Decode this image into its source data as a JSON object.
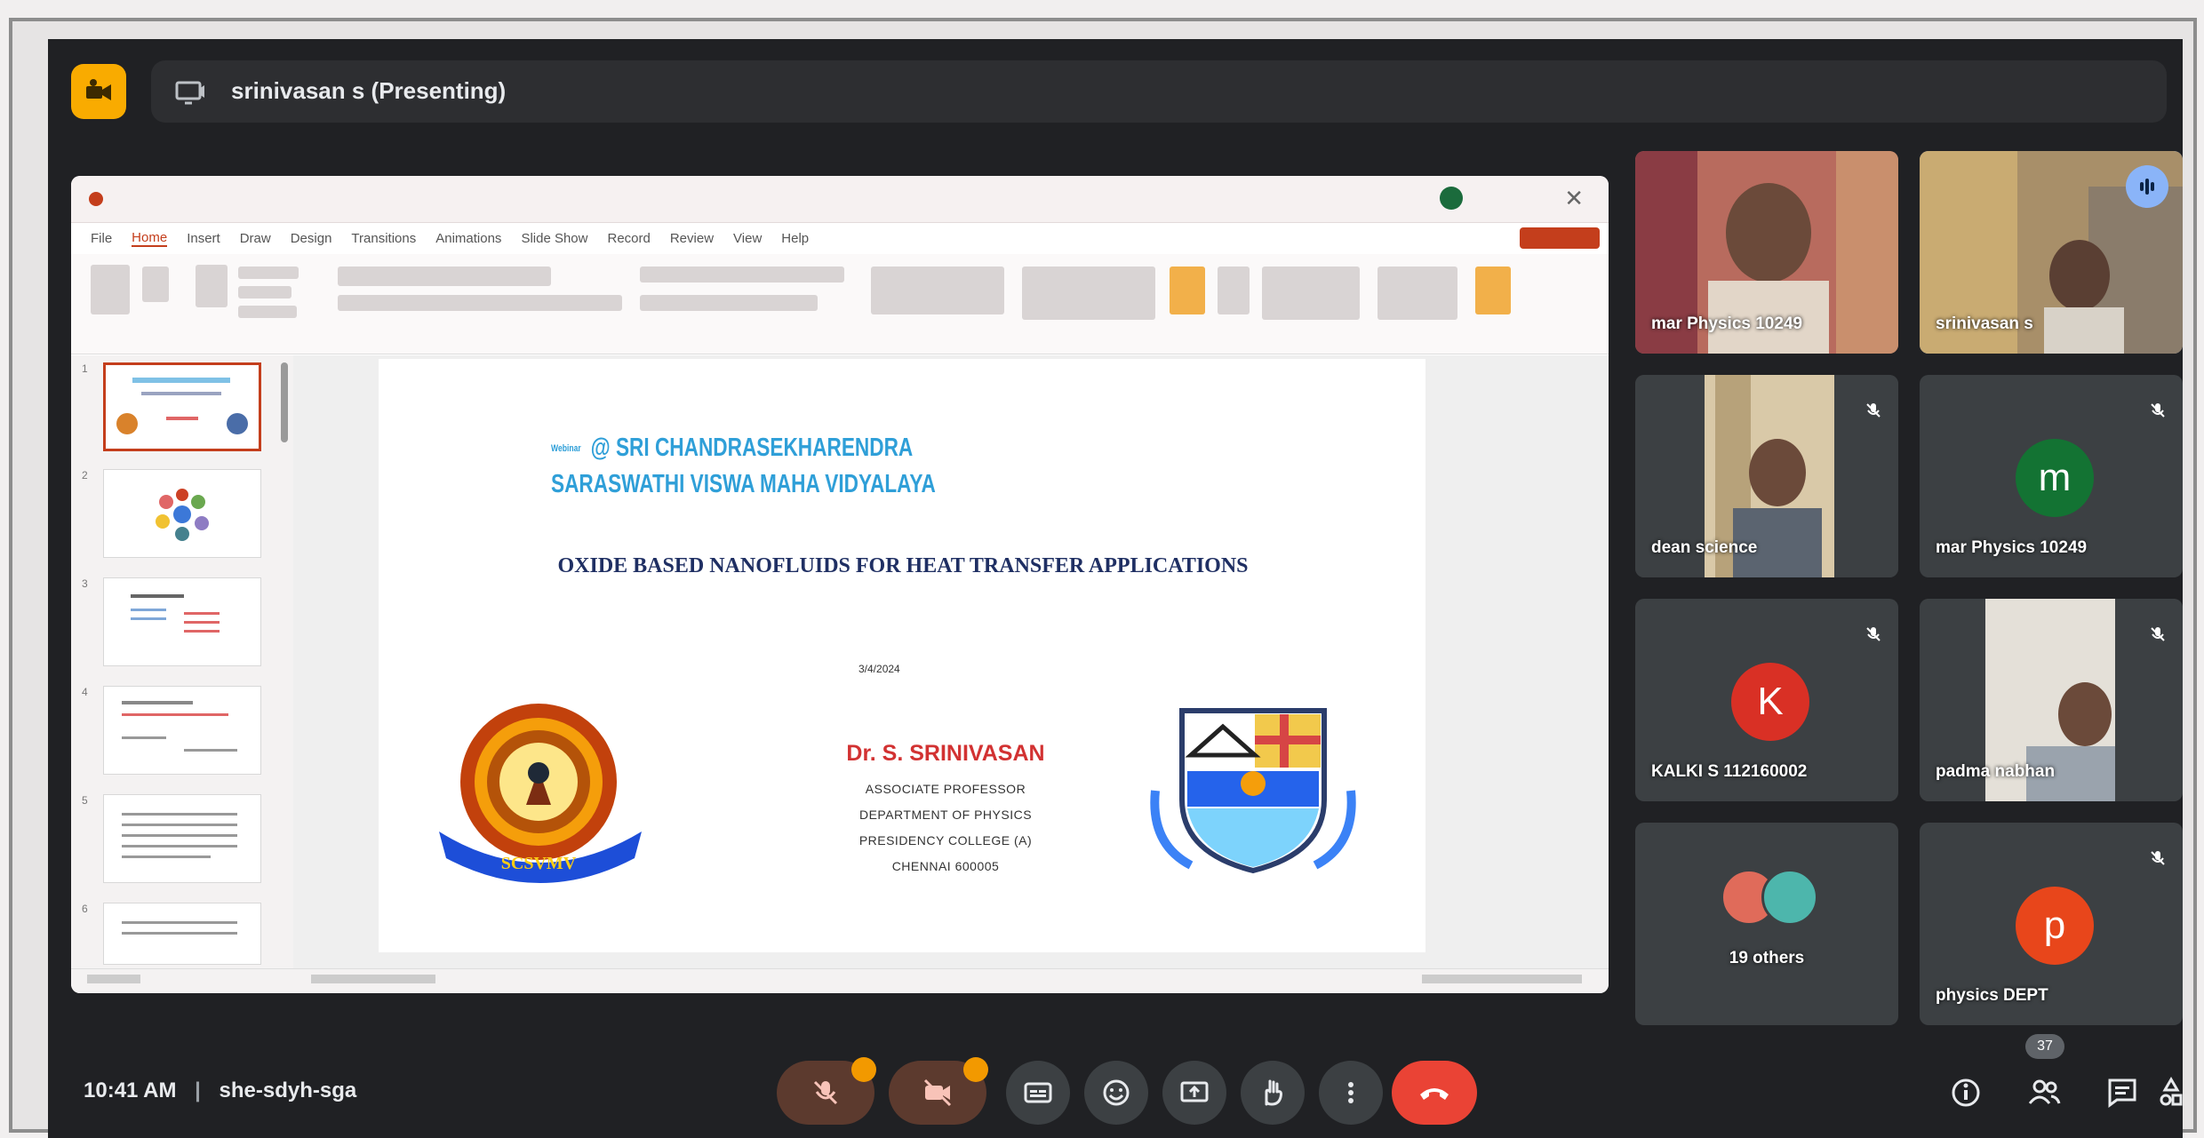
{
  "meeting": {
    "presenter_label": "srinivasan s (Presenting)",
    "time": "10:41 AM",
    "separator": "|",
    "code": "she-sdyh-sga",
    "participant_count": "37"
  },
  "ppt": {
    "tabs": [
      "File",
      "Home",
      "Insert",
      "Draw",
      "Design",
      "Transitions",
      "Animations",
      "Slide Show",
      "Record",
      "Review",
      "View",
      "Help"
    ],
    "active_tab": "Home",
    "thumb_numbers": [
      "1",
      "2",
      "3",
      "4",
      "5",
      "6"
    ]
  },
  "slide": {
    "institution_prefix": "Webinar",
    "institution": "@ SRI CHANDRASEKHARENDRA SARASWATHI VISWA MAHA VIDYALAYA",
    "title": "OXIDE BASED NANOFLUIDS FOR HEAT TRANSFER APPLICATIONS",
    "date": "3/4/2024",
    "speaker": "Dr. S. SRINIVASAN",
    "lines": [
      "ASSOCIATE PROFESSOR",
      "DEPARTMENT OF PHYSICS",
      "PRESIDENCY COLLEGE (A)",
      "CHENNAI 600005"
    ],
    "left_logo_text": "SCSVMV"
  },
  "participants": [
    {
      "name": "mar Physics 10249"
    },
    {
      "name": "srinivasan s"
    },
    {
      "name": "dean science"
    },
    {
      "name": "mar Physics 10249",
      "initial": "m",
      "color": "#137333"
    },
    {
      "name": "KALKI S 112160002",
      "initial": "K",
      "color": "#d93025"
    },
    {
      "name": "padma nabhan"
    },
    {
      "name": "19 others"
    },
    {
      "name": "physics DEPT",
      "initial": "p",
      "color": "#e8461b"
    }
  ],
  "colors": {
    "background": "#202124",
    "tile": "#3c4043",
    "leave": "#ea4335",
    "accent": "#8ab4f8"
  },
  "icons": [
    "mic-off-icon",
    "camera-off-icon",
    "captions-icon",
    "emoji-icon",
    "present-icon",
    "raise-hand-icon",
    "more-options-icon",
    "hang-up-icon",
    "info-icon",
    "people-icon",
    "chat-icon",
    "activities-icon"
  ]
}
